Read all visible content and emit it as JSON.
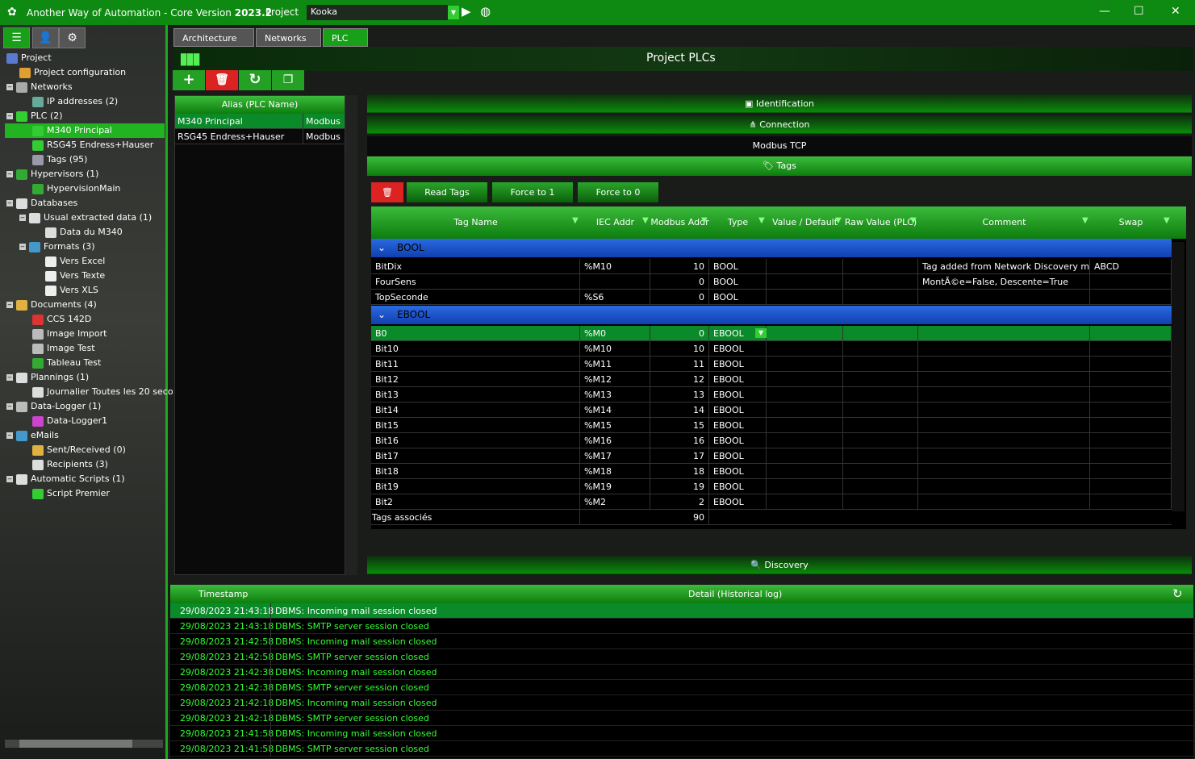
{
  "title": {
    "app": "Another Way of Automation - Core Version ",
    "version": "2023.2",
    "project_label": "Project",
    "project_value": "Kooka"
  },
  "tabs": [
    {
      "label": "Architecture"
    },
    {
      "label": "Networks"
    },
    {
      "label": "PLC"
    }
  ],
  "header": {
    "title": "Project PLCs"
  },
  "tree": [
    {
      "label": "Project",
      "lvl": 0,
      "c": "#5a7ad0"
    },
    {
      "label": "Project configuration",
      "lvl": 1,
      "c": "#e0a030"
    },
    {
      "label": "Networks",
      "lvl": 0,
      "c": "#aaa",
      "e": 1
    },
    {
      "label": "IP addresses (2)",
      "lvl": 2,
      "c": "#6a9"
    },
    {
      "label": "PLC (2)",
      "lvl": 0,
      "c": "#3c3",
      "e": 1
    },
    {
      "label": "M340 Principal",
      "lvl": 2,
      "c": "#3c3",
      "sel": 1
    },
    {
      "label": "RSG45 Endress+Hauser",
      "lvl": 2,
      "c": "#3c3"
    },
    {
      "label": "Tags (95)",
      "lvl": 2,
      "c": "#99a"
    },
    {
      "label": "Hypervisors (1)",
      "lvl": 0,
      "c": "#3a3",
      "e": 1
    },
    {
      "label": "HypervisionMain",
      "lvl": 2,
      "c": "#3a3"
    },
    {
      "label": "Databases",
      "lvl": 0,
      "c": "#ddd",
      "e": 1
    },
    {
      "label": "Usual extracted data (1)",
      "lvl": 1,
      "c": "#ddd",
      "e": 1
    },
    {
      "label": "Data du M340",
      "lvl": 3,
      "c": "#ddd"
    },
    {
      "label": "Formats (3)",
      "lvl": 1,
      "c": "#49c",
      "e": 1
    },
    {
      "label": "Vers Excel",
      "lvl": 3,
      "c": "#eee"
    },
    {
      "label": "Vers Texte",
      "lvl": 3,
      "c": "#eee"
    },
    {
      "label": "Vers XLS",
      "lvl": 3,
      "c": "#eee"
    },
    {
      "label": "Documents (4)",
      "lvl": 0,
      "c": "#e0b040",
      "e": 1
    },
    {
      "label": "CCS 142D",
      "lvl": 2,
      "c": "#d33"
    },
    {
      "label": "Image Import",
      "lvl": 2,
      "c": "#bbb"
    },
    {
      "label": "Image Test",
      "lvl": 2,
      "c": "#bbb"
    },
    {
      "label": "Tableau Test",
      "lvl": 2,
      "c": "#3a3"
    },
    {
      "label": "Plannings (1)",
      "lvl": 0,
      "c": "#ddd",
      "e": 1
    },
    {
      "label": "Journalier Toutes les 20 seco",
      "lvl": 2,
      "c": "#ddd"
    },
    {
      "label": "Data-Logger (1)",
      "lvl": 0,
      "c": "#bbb",
      "e": 1
    },
    {
      "label": "Data-Logger1",
      "lvl": 2,
      "c": "#c4c"
    },
    {
      "label": "eMails",
      "lvl": 0,
      "c": "#49c",
      "e": 1
    },
    {
      "label": "Sent/Received (0)",
      "lvl": 2,
      "c": "#e0b040"
    },
    {
      "label": "Recipients (3)",
      "lvl": 2,
      "c": "#ddd"
    },
    {
      "label": "Automatic Scripts (1)",
      "lvl": 0,
      "c": "#ddd",
      "e": 1
    },
    {
      "label": "Script Premier",
      "lvl": 2,
      "c": "#3c3"
    }
  ],
  "plc_list": {
    "header": "Alias (PLC Name)",
    "rows": [
      [
        "M340 Principal",
        "Modbus TCP"
      ],
      [
        "RSG45 Endress+Hauser",
        "Modbus TCP"
      ]
    ]
  },
  "sections": {
    "identification": "Identification",
    "connection": "Connection",
    "protocol": "Modbus TCP",
    "tags": "Tags",
    "discovery": "Discovery"
  },
  "actions": {
    "read": "Read Tags",
    "force1": "Force to 1",
    "force0": "Force to 0"
  },
  "grid": {
    "columns": [
      "Tag Name",
      "IEC Addr",
      "Modbus Addr",
      "Type",
      "Value / Default",
      "Raw Value (PLC)",
      "Comment",
      "Swap"
    ],
    "groups": [
      {
        "name": "BOOL",
        "rows": [
          [
            "BitDix",
            "%M10",
            "10",
            "BOOL",
            "",
            "",
            "Tag added from Network Discovery mode",
            "ABCD"
          ],
          [
            "FourSens",
            "",
            "0",
            "BOOL",
            "",
            "",
            "MontÃ©e=False, Descente=True",
            ""
          ],
          [
            "TopSeconde",
            "%S6",
            "0",
            "BOOL",
            "",
            "",
            "",
            ""
          ]
        ]
      },
      {
        "name": "EBOOL",
        "rows": [
          [
            "B0",
            "%M0",
            "0",
            "EBOOL",
            "",
            "",
            "",
            ""
          ],
          [
            "Bit10",
            "%M10",
            "10",
            "EBOOL",
            "",
            "",
            "",
            ""
          ],
          [
            "Bit11",
            "%M11",
            "11",
            "EBOOL",
            "",
            "",
            "",
            ""
          ],
          [
            "Bit12",
            "%M12",
            "12",
            "EBOOL",
            "",
            "",
            "",
            ""
          ],
          [
            "Bit13",
            "%M13",
            "13",
            "EBOOL",
            "",
            "",
            "",
            ""
          ],
          [
            "Bit14",
            "%M14",
            "14",
            "EBOOL",
            "",
            "",
            "",
            ""
          ],
          [
            "Bit15",
            "%M15",
            "15",
            "EBOOL",
            "",
            "",
            "",
            ""
          ],
          [
            "Bit16",
            "%M16",
            "16",
            "EBOOL",
            "",
            "",
            "",
            ""
          ],
          [
            "Bit17",
            "%M17",
            "17",
            "EBOOL",
            "",
            "",
            "",
            ""
          ],
          [
            "Bit18",
            "%M18",
            "18",
            "EBOOL",
            "",
            "",
            "",
            ""
          ],
          [
            "Bit19",
            "%M19",
            "19",
            "EBOOL",
            "",
            "",
            "",
            ""
          ],
          [
            "Bit2",
            "%M2",
            "2",
            "EBOOL",
            "",
            "",
            "",
            ""
          ]
        ]
      }
    ],
    "footer_label": "Tags associés",
    "footer_count": "90"
  },
  "log": {
    "columns": [
      "Timestamp",
      "Detail (Historical log)"
    ],
    "rows": [
      [
        "29/08/2023 21:43:18",
        "DBMS: Incoming mail session closed"
      ],
      [
        "29/08/2023 21:43:18",
        "DBMS: SMTP server session closed"
      ],
      [
        "29/08/2023 21:42:58",
        "DBMS: Incoming mail session closed"
      ],
      [
        "29/08/2023 21:42:58",
        "DBMS: SMTP server session closed"
      ],
      [
        "29/08/2023 21:42:38",
        "DBMS: Incoming mail session closed"
      ],
      [
        "29/08/2023 21:42:38",
        "DBMS: SMTP server session closed"
      ],
      [
        "29/08/2023 21:42:18",
        "DBMS: Incoming mail session closed"
      ],
      [
        "29/08/2023 21:42:18",
        "DBMS: SMTP server session closed"
      ],
      [
        "29/08/2023 21:41:58",
        "DBMS: Incoming mail session closed"
      ],
      [
        "29/08/2023 21:41:58",
        "DBMS: SMTP server session closed"
      ]
    ]
  }
}
